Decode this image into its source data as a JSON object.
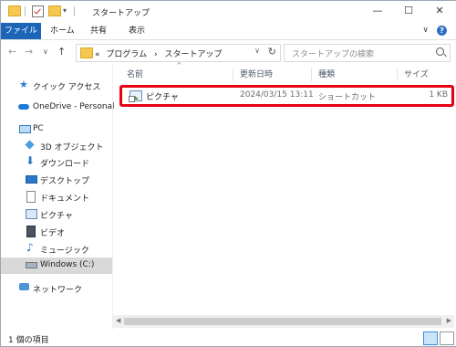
{
  "window": {
    "title": "スタートアップ",
    "controls": {
      "minimize": "—",
      "maximize": "☐",
      "close": "✕"
    }
  },
  "ribbon": {
    "file_tab": "ファイル",
    "tabs": [
      "ホーム",
      "共有",
      "表示"
    ],
    "collapse": "∨",
    "help": "?"
  },
  "address": {
    "prefix": "«",
    "path": [
      "プログラム",
      "スタートアップ"
    ],
    "separator": "›",
    "dropdown": "∨",
    "refresh": "↻"
  },
  "search": {
    "placeholder": "スタートアップの検索"
  },
  "nav_buttons": {
    "back": "←",
    "forward": "→",
    "recent": "∨",
    "up": "↑"
  },
  "nav_pane": [
    {
      "label": "クイック アクセス",
      "icon": "star-icon",
      "indent": 0
    },
    {
      "label": "OneDrive - Personal",
      "icon": "cloud-icon",
      "indent": 0
    },
    {
      "label": "PC",
      "icon": "pc-icon",
      "indent": 0
    },
    {
      "label": "3D オブジェクト",
      "icon": "3d-objects-icon",
      "indent": 1
    },
    {
      "label": "ダウンロード",
      "icon": "download-icon",
      "indent": 1
    },
    {
      "label": "デスクトップ",
      "icon": "desktop-icon",
      "indent": 1
    },
    {
      "label": "ドキュメント",
      "icon": "document-icon",
      "indent": 1
    },
    {
      "label": "ピクチャ",
      "icon": "pictures-icon",
      "indent": 1
    },
    {
      "label": "ビデオ",
      "icon": "video-icon",
      "indent": 1
    },
    {
      "label": "ミュージック",
      "icon": "music-icon",
      "indent": 1
    },
    {
      "label": "Windows (C:)",
      "icon": "drive-icon",
      "indent": 1,
      "selected": true
    },
    {
      "label": "ネットワーク",
      "icon": "network-icon",
      "indent": 0
    }
  ],
  "columns": {
    "name": "名前",
    "modified": "更新日時",
    "type": "種類",
    "size": "サイズ",
    "sort_indicator": "^"
  },
  "files": [
    {
      "name": "ピクチャ",
      "modified": "2024/03/15 13:11",
      "type": "ショートカット",
      "size": "1 KB"
    }
  ],
  "status": {
    "item_count": "1 個の項目"
  },
  "colors": {
    "accent": "#1a65b8",
    "highlight_border": "#e60012",
    "selected_nav": "#d9d9d9"
  }
}
